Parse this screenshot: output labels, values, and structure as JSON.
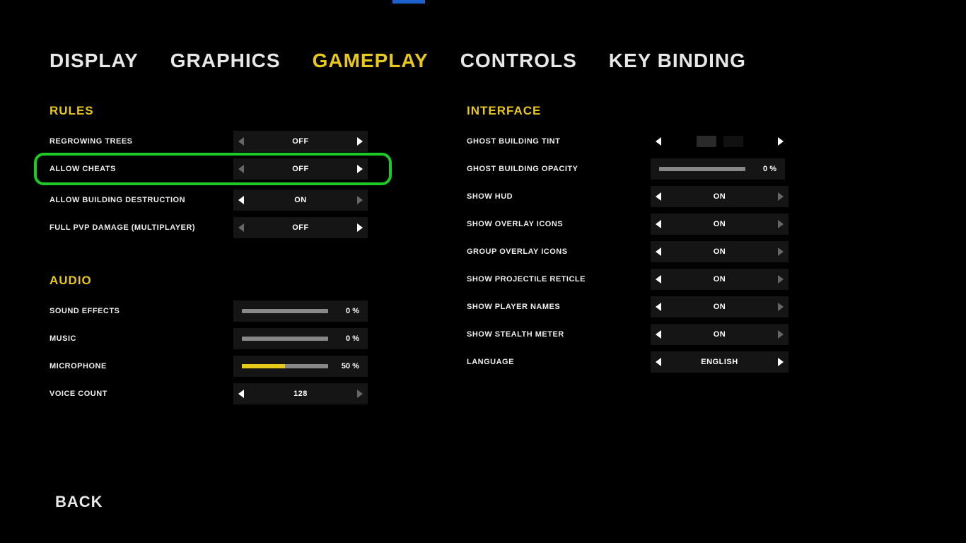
{
  "colors": {
    "accent": "#e8c918",
    "highlight": "#1cc926"
  },
  "tabs": {
    "display": "DISPLAY",
    "graphics": "GRAPHICS",
    "gameplay": "GAMEPLAY",
    "controls": "CONTROLS",
    "keybinding": "KEY BINDING",
    "active": "gameplay"
  },
  "sections": {
    "rules": {
      "title": "RULES",
      "regrowing_trees": {
        "label": "REGROWING TREES",
        "value": "OFF"
      },
      "allow_cheats": {
        "label": "ALLOW CHEATS",
        "value": "OFF",
        "highlighted": true
      },
      "allow_building_destruction": {
        "label": "ALLOW BUILDING DESTRUCTION",
        "value": "ON"
      },
      "full_pvp": {
        "label": "FULL PVP DAMAGE (MULTIPLAYER)",
        "value": "OFF"
      }
    },
    "audio": {
      "title": "AUDIO",
      "sound_effects": {
        "label": "SOUND EFFECTS",
        "pct": "0 %",
        "fill": 0
      },
      "music": {
        "label": "MUSIC",
        "pct": "0 %",
        "fill": 0
      },
      "microphone": {
        "label": "MICROPHONE",
        "pct": "50 %",
        "fill": 50
      },
      "voice_count": {
        "label": "VOICE COUNT",
        "value": "128"
      }
    },
    "interface": {
      "title": "INTERFACE",
      "ghost_tint": {
        "label": "GHOST BUILDING TINT",
        "swatches": [
          "#2a2a2a",
          "#111"
        ]
      },
      "ghost_opacity": {
        "label": "GHOST BUILDING OPACITY",
        "pct": "0 %",
        "fill": 0
      },
      "show_hud": {
        "label": "SHOW HUD",
        "value": "ON"
      },
      "show_overlay": {
        "label": "SHOW OVERLAY ICONS",
        "value": "ON"
      },
      "group_overlay": {
        "label": "GROUP OVERLAY ICONS",
        "value": "ON"
      },
      "show_reticle": {
        "label": "SHOW PROJECTILE RETICLE",
        "value": "ON"
      },
      "show_names": {
        "label": "SHOW PLAYER NAMES",
        "value": "ON"
      },
      "show_stealth": {
        "label": "SHOW STEALTH METER",
        "value": "ON"
      },
      "language": {
        "label": "LANGUAGE",
        "value": "ENGLISH"
      }
    }
  },
  "back": "BACK"
}
